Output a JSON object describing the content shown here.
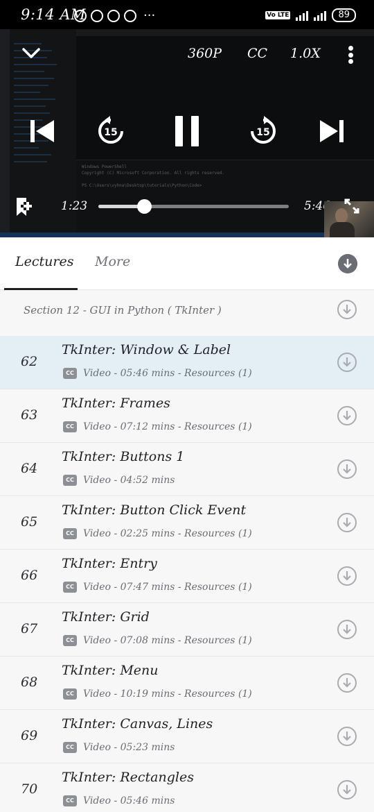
{
  "status_bar": {
    "time": "9:14 AM",
    "network": "4G",
    "volte": "Vo LTE",
    "battery": "89"
  },
  "player": {
    "quality": "360P",
    "captions": "CC",
    "speed": "1.0X",
    "rewind_seconds": "15",
    "forward_seconds": "15",
    "elapsed": "1:23",
    "duration": "5:46",
    "progress_fraction": 0.24,
    "terminal_lines": "Windows PowerShell\nCopyright (C) Microsoft Corporation. All rights reserved.\n\nPS C:\\Users\\vyhna\\Desktop\\tutorials\\Python\\Code>"
  },
  "tabs": {
    "lectures": "Lectures",
    "more": "More"
  },
  "section": {
    "title": "Section 12 - GUI in Python ( TkInter )"
  },
  "lectures": [
    {
      "number": "62",
      "title": "TkInter: Window & Label",
      "meta": "Video - 05:46 mins - Resources (1)",
      "active": true
    },
    {
      "number": "63",
      "title": "TkInter: Frames",
      "meta": "Video - 07:12 mins - Resources (1)",
      "active": false
    },
    {
      "number": "64",
      "title": "TkInter: Buttons 1",
      "meta": "Video - 04:52 mins",
      "active": false
    },
    {
      "number": "65",
      "title": "TkInter: Button Click Event",
      "meta": "Video - 02:25 mins - Resources (1)",
      "active": false
    },
    {
      "number": "66",
      "title": "TkInter: Entry",
      "meta": "Video - 07:47 mins - Resources (1)",
      "active": false
    },
    {
      "number": "67",
      "title": "TkInter: Grid",
      "meta": "Video - 07:08 mins - Resources (1)",
      "active": false
    },
    {
      "number": "68",
      "title": "TkInter: Menu",
      "meta": "Video - 10:19 mins - Resources (1)",
      "active": false
    },
    {
      "number": "69",
      "title": "TkInter: Canvas, Lines",
      "meta": "Video - 05:23 mins",
      "active": false
    },
    {
      "number": "70",
      "title": "TkInter: Rectangles",
      "meta": "Video - 05:46 mins",
      "active": false
    }
  ],
  "icons": {
    "collapse": "chevron-down-icon",
    "menu": "more-vert-icon",
    "previous": "skip-previous-icon",
    "rewind": "replay-15-icon",
    "pause": "pause-icon",
    "forward": "forward-15-icon",
    "next": "skip-next-icon",
    "bookmark": "bookmark-add-icon",
    "fullscreen": "fullscreen-icon",
    "download": "download-icon",
    "captions_badge": "cc-icon"
  }
}
